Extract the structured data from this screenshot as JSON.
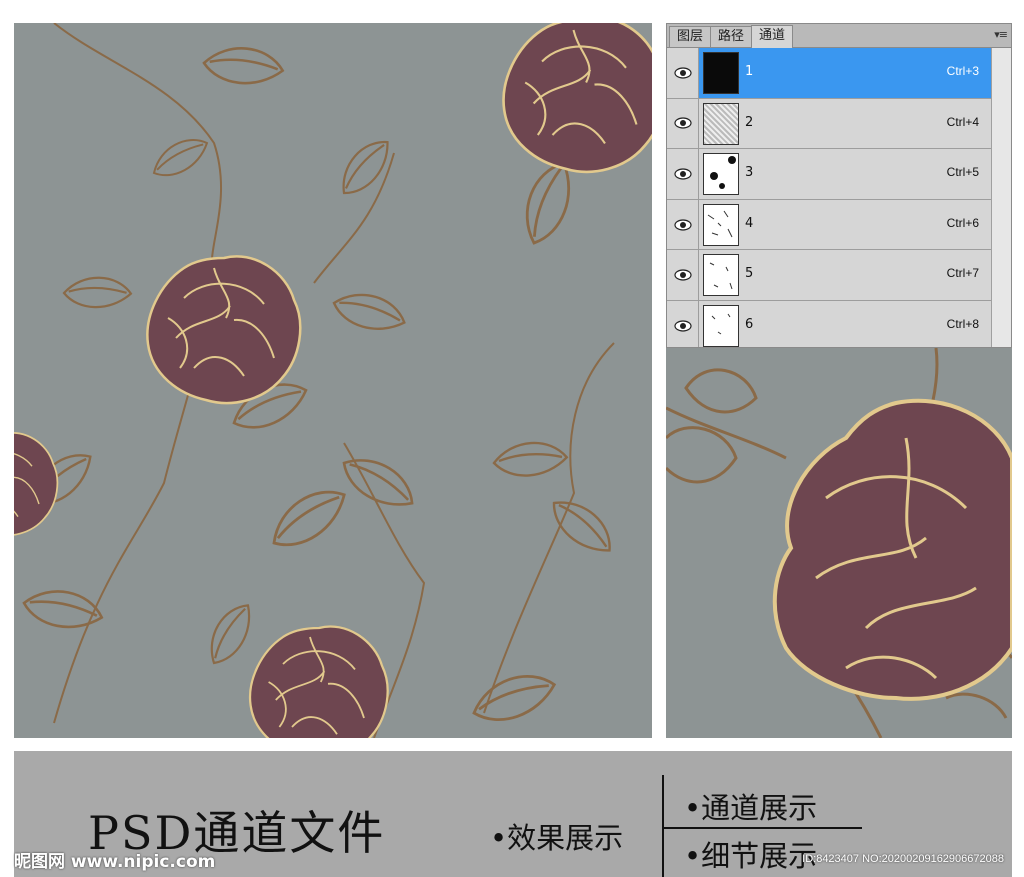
{
  "panel": {
    "tabs": [
      "图层",
      "路径",
      "通道"
    ],
    "active_tab": "通道",
    "menu_icon": "panel-menu-icon",
    "channels": [
      {
        "name": "1",
        "shortcut": "Ctrl+3",
        "selected": true
      },
      {
        "name": "2",
        "shortcut": "Ctrl+4",
        "selected": false
      },
      {
        "name": "3",
        "shortcut": "Ctrl+5",
        "selected": false
      },
      {
        "name": "4",
        "shortcut": "Ctrl+6",
        "selected": false
      },
      {
        "name": "5",
        "shortcut": "Ctrl+7",
        "selected": false
      },
      {
        "name": "6",
        "shortcut": "Ctrl+8",
        "selected": false
      }
    ]
  },
  "caption": {
    "title": "PSD通道文件",
    "effect_label": "•效果展示",
    "channel_label": "•通道展示",
    "detail_label": "•细节展示",
    "watermark_site": "昵图网 www.nipic.com",
    "watermark_id": "ID:8423407 NO:20200209162906672088"
  },
  "colors": {
    "background_gray": "#8d9494",
    "flower_fill": "#6e4650",
    "flower_outline": "#e2c98d",
    "leaf_stroke": "#8a6a48",
    "selected_row": "#3a97f0",
    "caption_bar": "#a9a9a9"
  }
}
